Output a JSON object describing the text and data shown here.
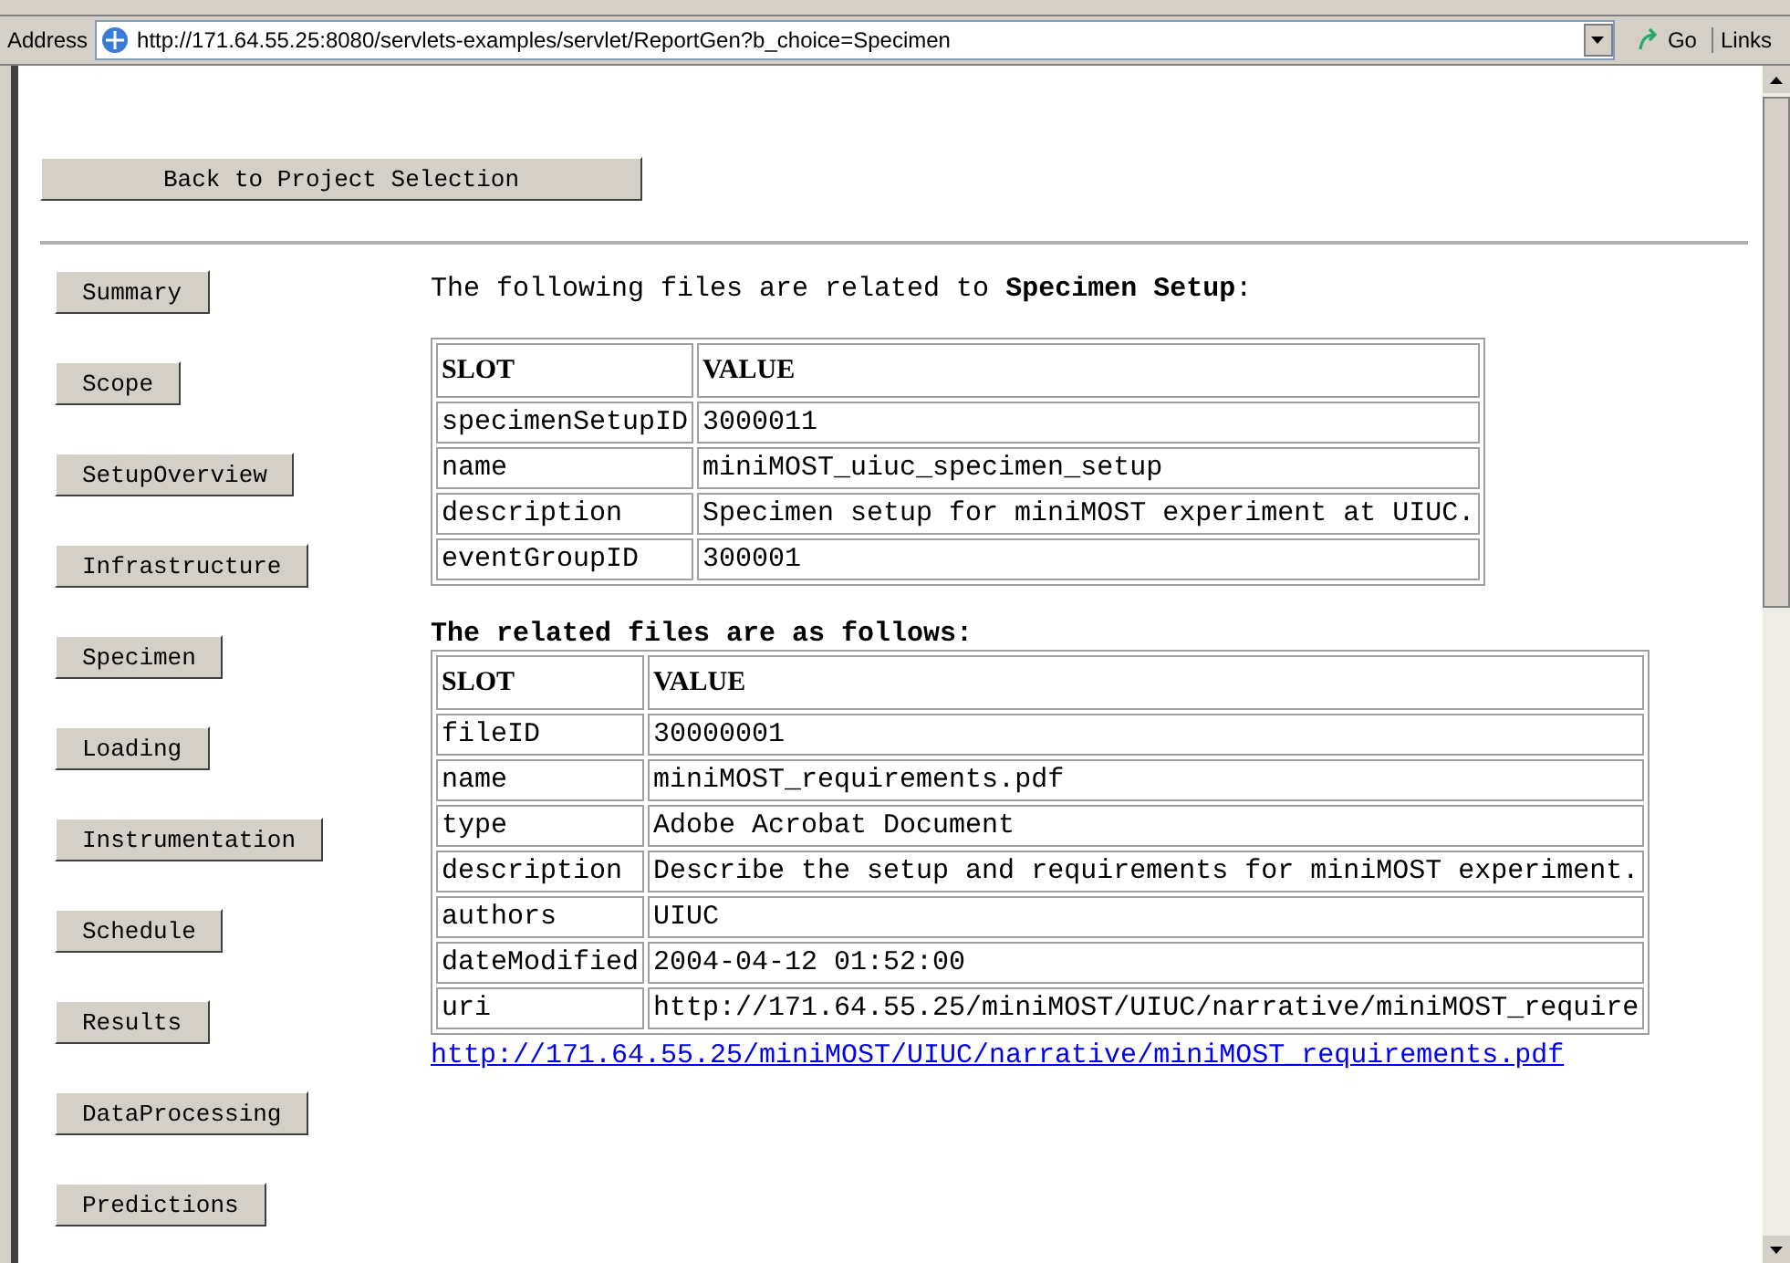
{
  "address_bar": {
    "label": "Address",
    "url": "http://171.64.55.25:8080/servlets-examples/servlet/ReportGen?b_choice=Specimen",
    "go": "Go",
    "links": "Links"
  },
  "back_button": "Back to Project Selection",
  "nav_buttons": [
    "Summary",
    "Scope",
    "SetupOverview",
    "Infrastructure",
    "Specimen",
    "Loading",
    "Instrumentation",
    "Schedule",
    "Results",
    "DataProcessing",
    "Predictions"
  ],
  "intro": "The following files are related to **Specimen Setup**:",
  "specimen_table": {
    "columns": [
      "SLOT",
      "VALUE"
    ],
    "rows": [
      [
        "specimenSetupID",
        "3000011"
      ],
      [
        "name",
        "miniMOST_uiuc_specimen_setup"
      ],
      [
        "description",
        "Specimen setup for miniMOST experiment at UIUC."
      ],
      [
        "eventGroupID",
        "300001"
      ]
    ]
  },
  "related_heading": "The related files are as follows:",
  "files_table": {
    "columns": [
      "SLOT",
      "VALUE"
    ],
    "rows": [
      [
        "fileID",
        "30000001"
      ],
      [
        "name",
        "miniMOST_requirements.pdf"
      ],
      [
        "type",
        "Adobe Acrobat Document"
      ],
      [
        "description",
        "Describe the setup and requirements for miniMOST experiment."
      ],
      [
        "authors",
        "UIUC"
      ],
      [
        "dateModified",
        "2004-04-12 01:52:00"
      ],
      [
        "uri",
        "http://171.64.55.25/miniMOST/UIUC/narrative/miniMOST_require"
      ]
    ]
  },
  "file_link": "http://171.64.55.25/miniMOST/UIUC/narrative/miniMOST_requirements.pdf"
}
